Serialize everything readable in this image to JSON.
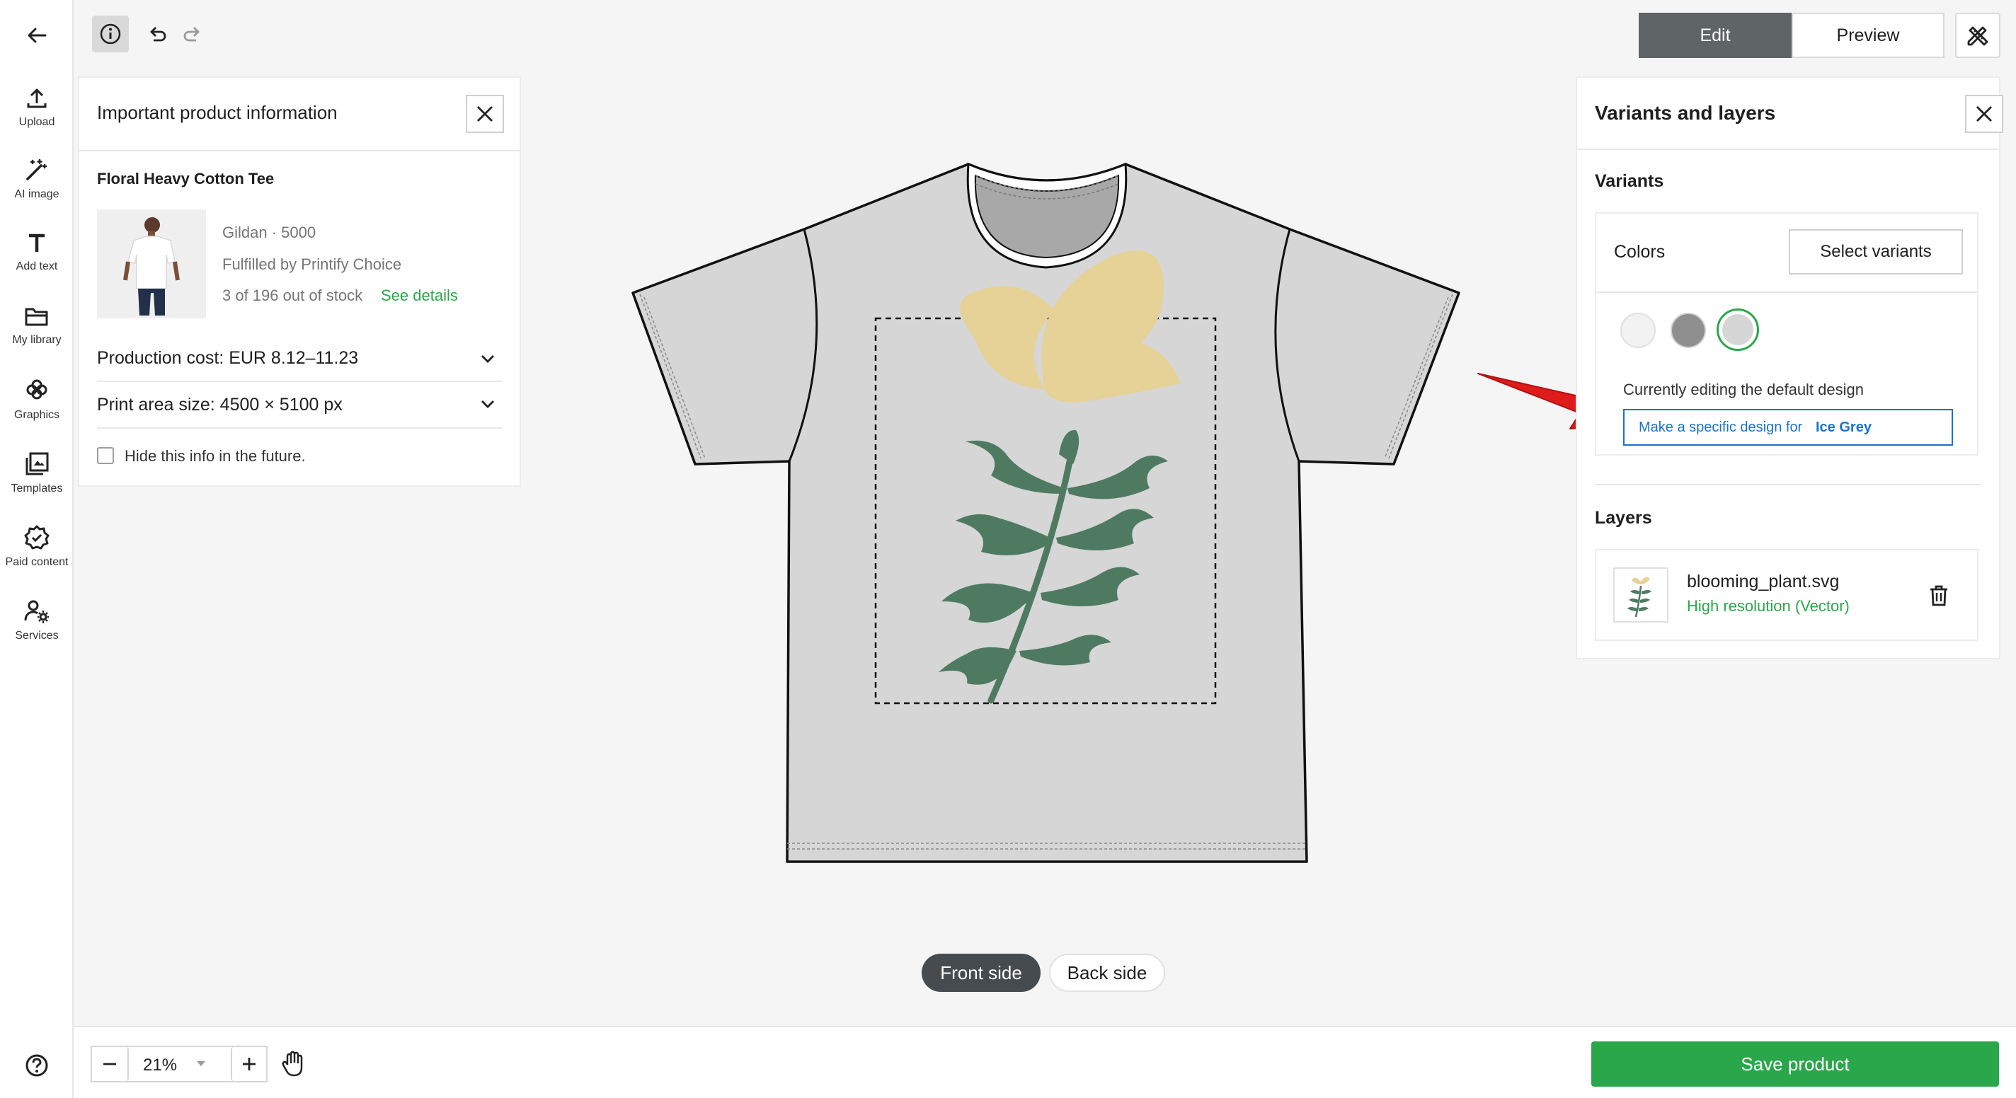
{
  "toolbar": {
    "back_icon": "arrow-left-icon",
    "tools": [
      {
        "label": "Upload",
        "icon": "upload-icon"
      },
      {
        "label": "AI image",
        "icon": "magic-wand-icon"
      },
      {
        "label": "Add text",
        "icon": "text-icon"
      },
      {
        "label": "My library",
        "icon": "folder-icon"
      },
      {
        "label": "Graphics",
        "icon": "flower-icon"
      },
      {
        "label": "Templates",
        "icon": "templates-icon"
      },
      {
        "label": "Paid content",
        "icon": "badge-check-icon"
      },
      {
        "label": "Services",
        "icon": "services-icon"
      }
    ],
    "help_icon": "help-icon"
  },
  "topbar": {
    "edit_label": "Edit",
    "preview_label": "Preview",
    "active_mode": "Edit"
  },
  "info_panel": {
    "title": "Important product information",
    "product_name": "Floral Heavy Cotton Tee",
    "brand": "Gildan · 5000",
    "fulfilled": "Fulfilled by Printify Choice",
    "stock": "3 of 196 out of stock",
    "see_details": "See details",
    "production_cost": "Production cost: EUR 8.12–11.23",
    "print_area": "Print area size: 4500 × 5100 px",
    "hide_label": "Hide this info in the future.",
    "hide_checked": false
  },
  "canvas": {
    "front_label": "Front side",
    "back_label": "Back side",
    "active_side": "Front side",
    "shirt_color": "#d6d6d6"
  },
  "variants_panel": {
    "title": "Variants and layers",
    "variants_heading": "Variants",
    "colors_label": "Colors",
    "select_variants_label": "Select variants",
    "swatches": [
      {
        "color": "#f2f2f2",
        "selected": false
      },
      {
        "color": "#8f8f8f",
        "selected": false
      },
      {
        "color": "#d6d6d6",
        "selected": true
      }
    ],
    "editing_note": "Currently editing the default design",
    "make_specific_prefix": "Make a specific design for",
    "make_specific_color": "Ice Grey",
    "layers_heading": "Layers",
    "layer": {
      "name": "blooming_plant.svg",
      "resolution": "High resolution (Vector)"
    }
  },
  "bottombar": {
    "zoom": "21%",
    "save_label": "Save product"
  },
  "colors": {
    "accent_green": "#2aa74a",
    "link_blue": "#1a73c9",
    "annotation_red": "#e01b1b",
    "active_dark": "#5f6567"
  }
}
